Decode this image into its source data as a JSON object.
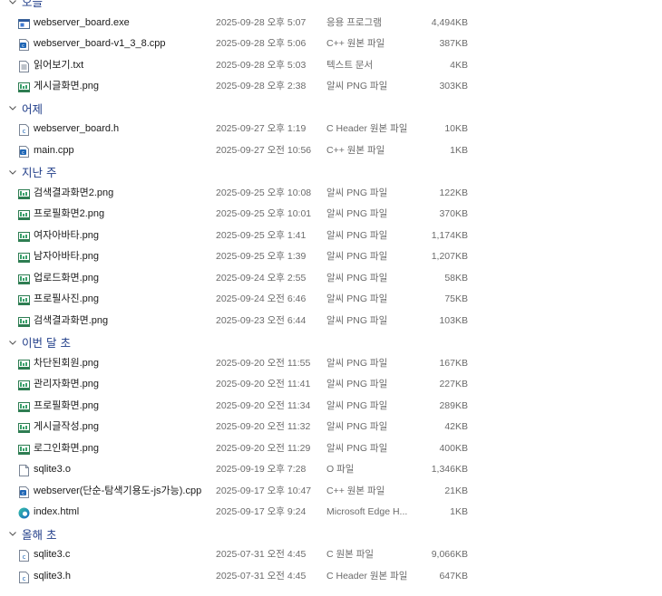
{
  "groups": [
    {
      "title": "오늘",
      "files": [
        {
          "name": "webserver_board.exe",
          "date": "2025-09-28 오후 5:07",
          "type": "응용 프로그램",
          "size": "4,494KB",
          "icon": "exe-icon"
        },
        {
          "name": "webserver_board-v1_3_8.cpp",
          "date": "2025-09-28 오후 5:06",
          "type": "C++ 원본 파일",
          "size": "387KB",
          "icon": "cpp-file-icon"
        },
        {
          "name": "읽어보기.txt",
          "date": "2025-09-28 오후 5:03",
          "type": "텍스트 문서",
          "size": "4KB",
          "icon": "text-file-icon"
        },
        {
          "name": "게시글화면.png",
          "date": "2025-09-28 오후 2:38",
          "type": "알씨 PNG 파일",
          "size": "303KB",
          "icon": "image-file-icon"
        }
      ]
    },
    {
      "title": "어제",
      "files": [
        {
          "name": "webserver_board.h",
          "date": "2025-09-27 오후 1:19",
          "type": "C Header 원본 파일",
          "size": "10KB",
          "icon": "c-file-icon"
        },
        {
          "name": "main.cpp",
          "date": "2025-09-27 오전 10:56",
          "type": "C++ 원본 파일",
          "size": "1KB",
          "icon": "cpp-file-icon"
        }
      ]
    },
    {
      "title": "지난 주",
      "files": [
        {
          "name": "검색결과화면2.png",
          "date": "2025-09-25 오후 10:08",
          "type": "알씨 PNG 파일",
          "size": "122KB",
          "icon": "image-file-icon"
        },
        {
          "name": "프로필화면2.png",
          "date": "2025-09-25 오후 10:01",
          "type": "알씨 PNG 파일",
          "size": "370KB",
          "icon": "image-file-icon"
        },
        {
          "name": "여자아바타.png",
          "date": "2025-09-25 오후 1:41",
          "type": "알씨 PNG 파일",
          "size": "1,174KB",
          "icon": "image-file-icon"
        },
        {
          "name": "남자아바타.png",
          "date": "2025-09-25 오후 1:39",
          "type": "알씨 PNG 파일",
          "size": "1,207KB",
          "icon": "image-file-icon"
        },
        {
          "name": "업로드화면.png",
          "date": "2025-09-24 오후 2:55",
          "type": "알씨 PNG 파일",
          "size": "58KB",
          "icon": "image-file-icon"
        },
        {
          "name": "프로필사진.png",
          "date": "2025-09-24 오전 6:46",
          "type": "알씨 PNG 파일",
          "size": "75KB",
          "icon": "image-file-icon"
        },
        {
          "name": "검색결과화면.png",
          "date": "2025-09-23 오전 6:44",
          "type": "알씨 PNG 파일",
          "size": "103KB",
          "icon": "image-file-icon"
        }
      ]
    },
    {
      "title": "이번 달 초",
      "files": [
        {
          "name": "차단된회원.png",
          "date": "2025-09-20 오전 11:55",
          "type": "알씨 PNG 파일",
          "size": "167KB",
          "icon": "image-file-icon"
        },
        {
          "name": "관리자화면.png",
          "date": "2025-09-20 오전 11:41",
          "type": "알씨 PNG 파일",
          "size": "227KB",
          "icon": "image-file-icon"
        },
        {
          "name": "프로필화면.png",
          "date": "2025-09-20 오전 11:34",
          "type": "알씨 PNG 파일",
          "size": "289KB",
          "icon": "image-file-icon"
        },
        {
          "name": "게시글작성.png",
          "date": "2025-09-20 오전 11:32",
          "type": "알씨 PNG 파일",
          "size": "42KB",
          "icon": "image-file-icon"
        },
        {
          "name": "로그인화면.png",
          "date": "2025-09-20 오전 11:29",
          "type": "알씨 PNG 파일",
          "size": "400KB",
          "icon": "image-file-icon"
        },
        {
          "name": "sqlite3.o",
          "date": "2025-09-19 오후 7:28",
          "type": "O 파일",
          "size": "1,346KB",
          "icon": "blank-file-icon"
        },
        {
          "name": "webserver(단순-탐색기용도-js가능).cpp",
          "date": "2025-09-17 오후 10:47",
          "type": "C++ 원본 파일",
          "size": "21KB",
          "icon": "cpp-file-icon"
        },
        {
          "name": "index.html",
          "date": "2025-09-17 오후 9:24",
          "type": "Microsoft Edge H...",
          "size": "1KB",
          "icon": "edge-icon"
        }
      ]
    },
    {
      "title": "올해 초",
      "files": [
        {
          "name": "sqlite3.c",
          "date": "2025-07-31 오전 4:45",
          "type": "C 원본 파일",
          "size": "9,066KB",
          "icon": "c-file-icon"
        },
        {
          "name": "sqlite3.h",
          "date": "2025-07-31 오전 4:45",
          "type": "C Header 원본 파일",
          "size": "647KB",
          "icon": "c-file-icon"
        }
      ]
    }
  ]
}
